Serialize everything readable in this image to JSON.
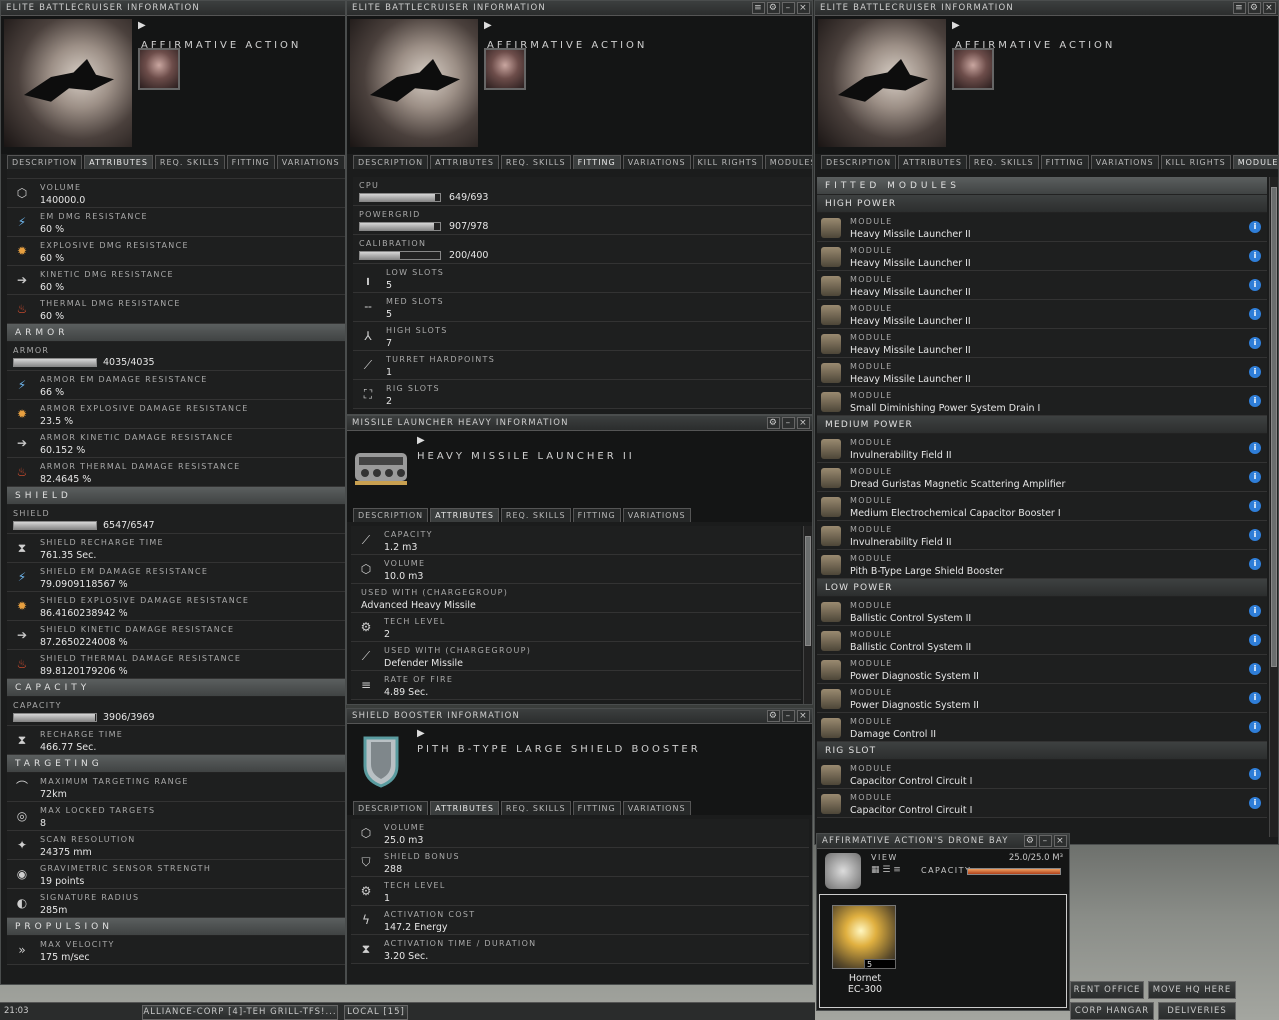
{
  "window_title": "ELITE BATTLECRUISER INFORMATION",
  "ship_name": "AFFIRMATIVE  ACTION",
  "tabs_short": [
    "DESCRIPTION",
    "ATTRIBUTES",
    "REQ. SKILLS",
    "FITTING",
    "VARIATIONS"
  ],
  "tabs_full": [
    "DESCRIPTION",
    "ATTRIBUTES",
    "REQ. SKILLS",
    "FITTING",
    "VARIATIONS",
    "KILL RIGHTS",
    "MODULES"
  ],
  "attributes": {
    "rows_top": [
      {
        "label": "VOLUME",
        "value": "140000.0",
        "icon": "volume-icon"
      },
      {
        "label": "EM DMG RESISTANCE",
        "value": "60 %",
        "icon": "em-icon"
      },
      {
        "label": "EXPLOSIVE DMG RESISTANCE",
        "value": "60 %",
        "icon": "explosive-icon"
      },
      {
        "label": "KINETIC DMG RESISTANCE",
        "value": "60 %",
        "icon": "kinetic-icon"
      },
      {
        "label": "THERMAL DMG RESISTANCE",
        "value": "60 %",
        "icon": "thermal-icon"
      }
    ],
    "armor_section": "ARMOR",
    "armor_bar": {
      "label": "ARMOR",
      "value": "4035/4035",
      "fraction": 1.0
    },
    "armor_rows": [
      {
        "label": "ARMOR EM DAMAGE RESISTANCE",
        "value": "66 %",
        "icon": "em-icon"
      },
      {
        "label": "ARMOR EXPLOSIVE DAMAGE RESISTANCE",
        "value": "23.5 %",
        "icon": "explosive-icon"
      },
      {
        "label": "ARMOR KINETIC DAMAGE RESISTANCE",
        "value": "60.152 %",
        "icon": "kinetic-icon"
      },
      {
        "label": "ARMOR THERMAL DAMAGE RESISTANCE",
        "value": "82.4645 %",
        "icon": "thermal-icon"
      }
    ],
    "shield_section": "SHIELD",
    "shield_bar": {
      "label": "SHIELD",
      "value": "6547/6547",
      "fraction": 1.0
    },
    "shield_rows": [
      {
        "label": "SHIELD RECHARGE TIME",
        "value": "761.35 Sec.",
        "icon": "hourglass-icon"
      },
      {
        "label": "SHIELD EM DAMAGE RESISTANCE",
        "value": "79.0909118567 %",
        "icon": "em-icon"
      },
      {
        "label": "SHIELD EXPLOSIVE DAMAGE RESISTANCE",
        "value": "86.4160238942 %",
        "icon": "explosive-icon"
      },
      {
        "label": "SHIELD KINETIC DAMAGE RESISTANCE",
        "value": "87.2650224008 %",
        "icon": "kinetic-icon"
      },
      {
        "label": "SHIELD THERMAL DAMAGE RESISTANCE",
        "value": "89.8120179206 %",
        "icon": "thermal-icon"
      }
    ],
    "capacity_section": "CAPACITY",
    "capacity_bar": {
      "label": "CAPACITY",
      "value": "3906/3969",
      "fraction": 0.984
    },
    "capacity_rows": [
      {
        "label": "RECHARGE TIME",
        "value": "466.77 Sec.",
        "icon": "hourglass-icon"
      }
    ],
    "targeting_section": "TARGETING",
    "targeting_rows": [
      {
        "label": "MAXIMUM TARGETING RANGE",
        "value": "72km",
        "icon": "range-icon"
      },
      {
        "label": "MAX LOCKED TARGETS",
        "value": "8",
        "icon": "target-icon"
      },
      {
        "label": "SCAN RESOLUTION",
        "value": "24375 mm",
        "icon": "scan-icon"
      },
      {
        "label": "GRAVIMETRIC SENSOR STRENGTH",
        "value": "19 points",
        "icon": "sensor-icon"
      },
      {
        "label": "SIGNATURE RADIUS",
        "value": "285m",
        "icon": "signature-icon"
      }
    ],
    "propulsion_section": "PROPULSION",
    "propulsion_rows": [
      {
        "label": "MAX VELOCITY",
        "value": "175 m/sec",
        "icon": "velocity-icon"
      }
    ]
  },
  "fitting": {
    "bars": [
      {
        "label": "CPU",
        "value": "649/693",
        "fraction": 0.936
      },
      {
        "label": "POWERGRID",
        "value": "907/978",
        "fraction": 0.927
      },
      {
        "label": "CALIBRATION",
        "value": "200/400",
        "fraction": 0.5
      }
    ],
    "rows": [
      {
        "label": "LOW SLOTS",
        "value": "5",
        "icon": "low-slot-icon"
      },
      {
        "label": "MED SLOTS",
        "value": "5",
        "icon": "med-slot-icon"
      },
      {
        "label": "HIGH SLOTS",
        "value": "7",
        "icon": "high-slot-icon"
      },
      {
        "label": "TURRET HARDPOINTS",
        "value": "1",
        "icon": "turret-icon"
      },
      {
        "label": "RIG SLOTS",
        "value": "2",
        "icon": "rig-slot-icon"
      }
    ]
  },
  "missile_window": {
    "title": "MISSILE LAUNCHER HEAVY INFORMATION",
    "name": "HEAVY MISSILE LAUNCHER II",
    "rows": [
      {
        "label": "CAPACITY",
        "value": "1.2 m3",
        "icon": "capacity-icon"
      },
      {
        "label": "VOLUME",
        "value": "10.0 m3",
        "icon": "volume-icon"
      },
      {
        "label": "USED WITH (CHARGEGROUP)",
        "value": "Advanced Heavy Missile",
        "icon": ""
      },
      {
        "label": "TECH LEVEL",
        "value": "2",
        "icon": "tech-icon"
      },
      {
        "label": "USED WITH (CHARGEGROUP)",
        "value": "Defender Missile",
        "icon": "missile-icon"
      },
      {
        "label": "RATE OF FIRE",
        "value": "4.89 Sec.",
        "icon": "rate-icon"
      }
    ]
  },
  "shield_window": {
    "title": "SHIELD BOOSTER INFORMATION",
    "name": "PITH B-TYPE LARGE SHIELD BOOSTER",
    "rows": [
      {
        "label": "VOLUME",
        "value": "25.0 m3",
        "icon": "volume-icon"
      },
      {
        "label": "SHIELD BONUS",
        "value": "288",
        "icon": "shield-icon"
      },
      {
        "label": "TECH LEVEL",
        "value": "1",
        "icon": "tech-icon"
      },
      {
        "label": "ACTIVATION COST",
        "value": "147.2 Energy",
        "icon": "energy-icon"
      },
      {
        "label": "ACTIVATION TIME / DURATION",
        "value": "3.20 Sec.",
        "icon": "hourglass-icon"
      }
    ]
  },
  "modules": {
    "header": "FITTED MODULES",
    "module_label": "MODULE",
    "groups": [
      {
        "name": "HIGH POWER",
        "items": [
          "Heavy Missile Launcher II",
          "Heavy Missile Launcher II",
          "Heavy Missile Launcher II",
          "Heavy Missile Launcher II",
          "Heavy Missile Launcher II",
          "Heavy Missile Launcher II",
          "Small Diminishing Power System Drain I"
        ]
      },
      {
        "name": "MEDIUM POWER",
        "items": [
          "Invulnerability Field II",
          "Dread Guristas Magnetic Scattering Amplifier",
          "Medium Electrochemical Capacitor Booster I",
          "Invulnerability Field II",
          "Pith B-Type Large Shield Booster"
        ]
      },
      {
        "name": "LOW POWER",
        "items": [
          "Ballistic Control System II",
          "Ballistic Control System II",
          "Power Diagnostic System II",
          "Power Diagnostic System II",
          "Damage Control II"
        ]
      },
      {
        "name": "RIG SLOT",
        "items": [
          "Capacitor Control Circuit I",
          "Capacitor Control Circuit I"
        ]
      }
    ]
  },
  "drone_bay": {
    "title": "AFFIRMATIVE ACTION'S DRONE BAY",
    "view_label": "VIEW",
    "capacity_label": "CAPACITY",
    "capacity_value": "25.0/25.0 M³",
    "capacity_fraction": 1.0,
    "item_name": "Hornet",
    "item_sub": "EC-300",
    "item_qty": "5"
  },
  "station_buttons": [
    "RENT OFFICE",
    "MOVE HQ HERE",
    "CORP HANGAR",
    "DELIVERIES"
  ],
  "chat_tabs": [
    "ALLIANCE-CORP [4]-TEH GRILL-TFS!...",
    "LOCAL [15]"
  ],
  "clock": "21:03",
  "colors": {
    "accent": "#2f7ed8",
    "panel": "#1e1f1f",
    "section": "#4b4e4e"
  }
}
